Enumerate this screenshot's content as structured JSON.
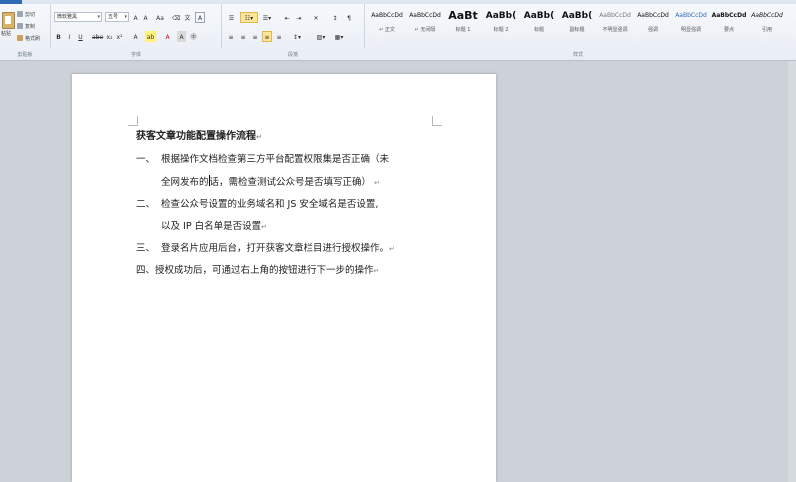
{
  "ribbon": {
    "clipboard": {
      "paste_label": "粘贴",
      "cut_label": "剪切",
      "copy_label": "复制",
      "format_painter_label": "格式刷",
      "group_label": "剪贴板"
    },
    "font": {
      "family": "微软雅黑",
      "size": "五号",
      "group_label": "字体"
    },
    "paragraph": {
      "group_label": "段落"
    },
    "styles": {
      "group_label": "样式",
      "items": [
        {
          "sample": "AaBbCcDd",
          "name": "↵ 正文"
        },
        {
          "sample": "AaBbCcDd",
          "name": "↵ 无间隔"
        },
        {
          "sample": "AaBt",
          "name": "标题 1"
        },
        {
          "sample": "AaBb(",
          "name": "标题 2"
        },
        {
          "sample": "AaBb(",
          "name": "标题"
        },
        {
          "sample": "AaBb(",
          "name": "副标题"
        },
        {
          "sample": "AaBbCcDd",
          "name": "不明显强调"
        },
        {
          "sample": "AaBbCcDd",
          "name": "强调"
        },
        {
          "sample": "AaBbCcDd",
          "name": "明显强调"
        },
        {
          "sample": "AaBbCcDd",
          "name": "要点"
        },
        {
          "sample": "AaBbCcDd",
          "name": "引用"
        }
      ]
    }
  },
  "document": {
    "title": "获客文章功能配置操作流程",
    "item1_num": "一、",
    "item1_line1": "根据操作文档检查第三方平台配置权限集是否正确（未",
    "item1_line2a": "全网发布的",
    "item1_line2b": "话，需检查测试公众号是否填写正确）",
    "item2_num": "二、",
    "item2_line1": "检查公众号设置的业务域名和 JS 安全域名是否设置,",
    "item2_line2": "以及 IP 白名单是否设置",
    "item3_num": "三、",
    "item3_line1": "登录名片应用后台，打开获客文章栏目进行授权操作。",
    "item4": "四、授权成功后，可通过右上角的按钮进行下一步的操作",
    "para_mark": "↵"
  }
}
